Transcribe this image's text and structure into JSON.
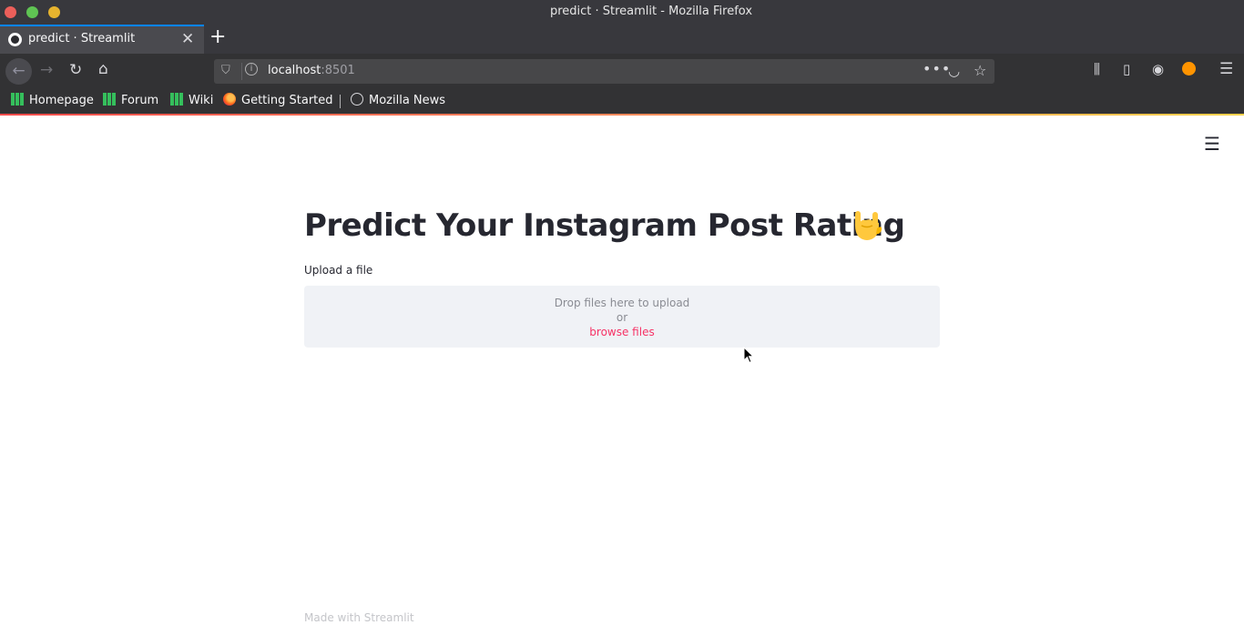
{
  "window": {
    "title": "predict · Streamlit - Mozilla Firefox"
  },
  "tabs": [
    {
      "title": "predict · Streamlit",
      "active": true
    }
  ],
  "urlbar": {
    "host": "localhost",
    "port": ":8501"
  },
  "bookmarks": [
    {
      "label": "Homepage",
      "icon": "manjaro-icon"
    },
    {
      "label": "Forum",
      "icon": "manjaro-icon"
    },
    {
      "label": "Wiki",
      "icon": "manjaro-icon"
    },
    {
      "label": "Getting Started",
      "icon": "firefox-icon"
    },
    {
      "label": "Mozilla News",
      "icon": "globe-icon"
    }
  ],
  "page": {
    "title": "Predict Your Instagram Post Rating",
    "title_emoji": "sign-of-the-horns-emoji",
    "uploader": {
      "label": "Upload a file",
      "drop_text": "Drop files here to upload",
      "or_text": "or",
      "browse_text": "browse files"
    },
    "footer": "Made with Streamlit"
  },
  "colors": {
    "accent": "#f63366",
    "tab_highlight": "#0a84ff",
    "dropzone_bg": "#f0f2f6",
    "text": "#262730"
  }
}
